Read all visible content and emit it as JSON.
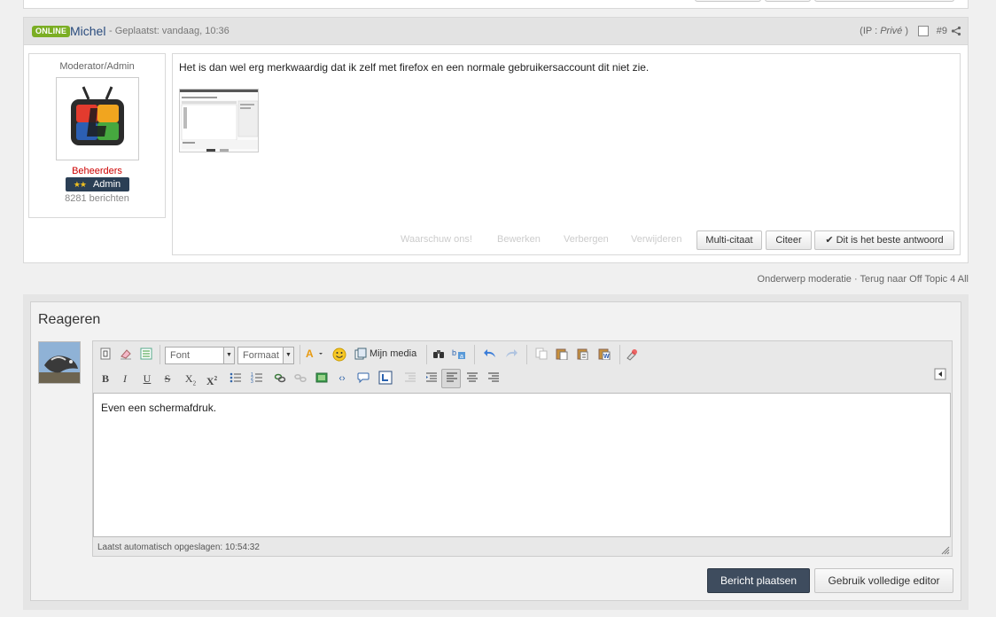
{
  "post": {
    "online_badge": "ONLINE",
    "author": "Michel",
    "posted": "- Geplaatst: vandaag, 10:36",
    "ip_prefix": "(IP : ",
    "ip_value": "Privé",
    "ip_suffix": " )",
    "post_number": "#9",
    "user": {
      "title": "Moderator/Admin",
      "group": "Beheerders",
      "rank_stars": "★★",
      "rank": "Admin",
      "post_count": "8281 berichten"
    },
    "message": "Het is dan wel erg merkwaardig dat ik zelf met firefox en een normale gebruikersaccount dit niet zie.",
    "links": {
      "warn": "Waarschuw ons!",
      "edit": "Bewerken",
      "hide": "Verbergen",
      "delete": "Verwijderen"
    },
    "buttons": {
      "multiquote": "Multi-citaat",
      "quote": "Citeer",
      "best_answer": "✔ Dit is het beste antwoord"
    }
  },
  "moderation": {
    "text": "Onderwerp moderatie · Terug naar Off Topic 4 All"
  },
  "reply": {
    "title": "Reageren",
    "editor": {
      "font_select": "Font",
      "format_select": "Formaat",
      "media_label": "Mijn media",
      "content": "Even een schermafdruk.",
      "autosave": "Laatst automatisch opgeslagen: 10:54:32"
    },
    "submit": "Bericht plaatsen",
    "full_editor": "Gebruik volledige editor"
  },
  "colors": {
    "online": "#7bae24",
    "author": "#2a4c7e",
    "group": "#cc0000",
    "submit_bg": "#3e4c5e"
  }
}
